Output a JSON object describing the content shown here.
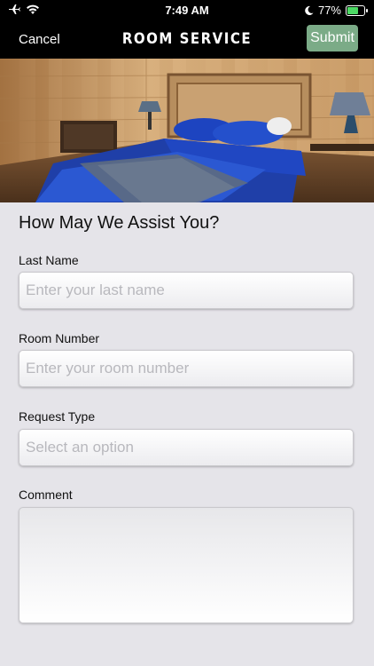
{
  "status_bar": {
    "time": "7:49 AM",
    "battery_percent": "77%",
    "battery_level": 0.77,
    "icons": [
      "airplane-icon",
      "wifi-icon",
      "moon-icon",
      "battery-charging-icon"
    ]
  },
  "nav": {
    "cancel_label": "Cancel",
    "title": "ROOM SERVICE",
    "submit_label": "Submit",
    "submit_color": "#7bab87"
  },
  "hero_image": {
    "icon": "hotel-room-photo"
  },
  "form": {
    "heading": "How May We Assist You?",
    "last_name": {
      "label": "Last Name",
      "placeholder": "Enter your last name",
      "value": ""
    },
    "room_number": {
      "label": "Room Number",
      "placeholder": "Enter your room number",
      "value": ""
    },
    "request_type": {
      "label": "Request Type",
      "placeholder": "Select an option",
      "value": ""
    },
    "comment": {
      "label": "Comment",
      "value": ""
    }
  },
  "colors": {
    "background": "#e5e4e9",
    "bar": "#000000"
  }
}
